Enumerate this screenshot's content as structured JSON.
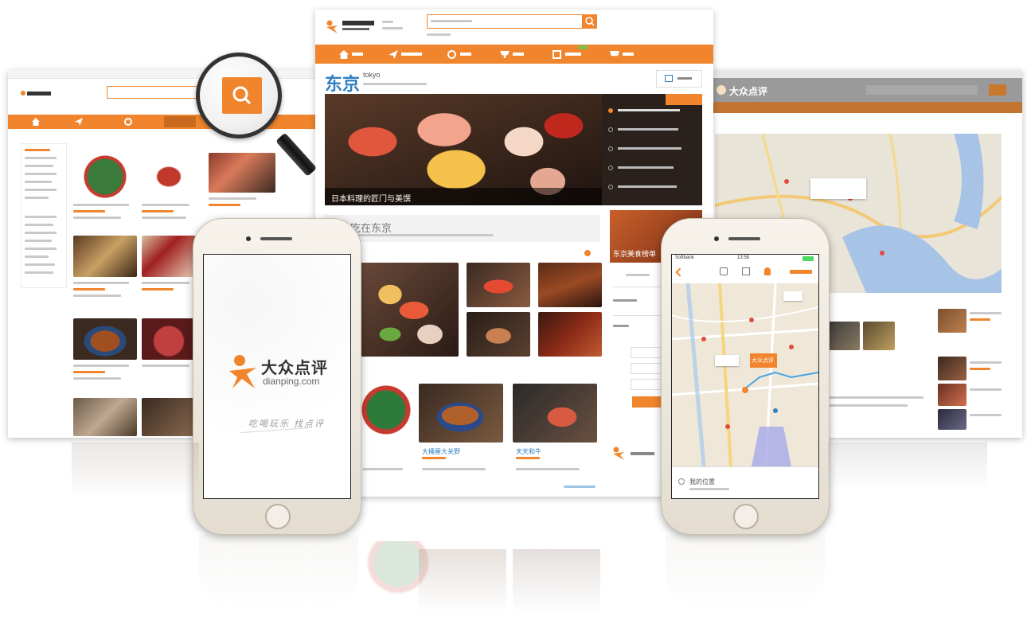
{
  "brand": {
    "name_cn": "大众点评",
    "domain": "dianping.com",
    "slogan": "吃喝玩乐 找点评",
    "accent_color": "#f0852d"
  },
  "center_window": {
    "city_cn": "东京",
    "city_en": "tokyo",
    "nav_items": [
      {
        "icon": "home-icon"
      },
      {
        "icon": "plane-icon"
      },
      {
        "icon": "gear-icon"
      },
      {
        "icon": "fork-icon"
      },
      {
        "icon": "hotel-icon"
      },
      {
        "icon": "cart-icon"
      }
    ],
    "hero_caption": "日本料理的匠门与美馔",
    "section_title": "吃在东京",
    "promo_badge": "东京美食榜单",
    "dish_titles": [
      "大桶屋大关野",
      "天天和牛"
    ]
  },
  "left_window": {
    "icons": [
      "home-icon",
      "plane-icon",
      "gear-icon",
      "fork-icon"
    ]
  },
  "right_window": {
    "brand_cn": "大众点评"
  },
  "right_phone": {
    "carrier": "Softbank",
    "time": "13:58",
    "map_pin_label": "大众点评",
    "footer_text": "我的位置"
  },
  "magnifier": {
    "icon": "search-icon"
  }
}
